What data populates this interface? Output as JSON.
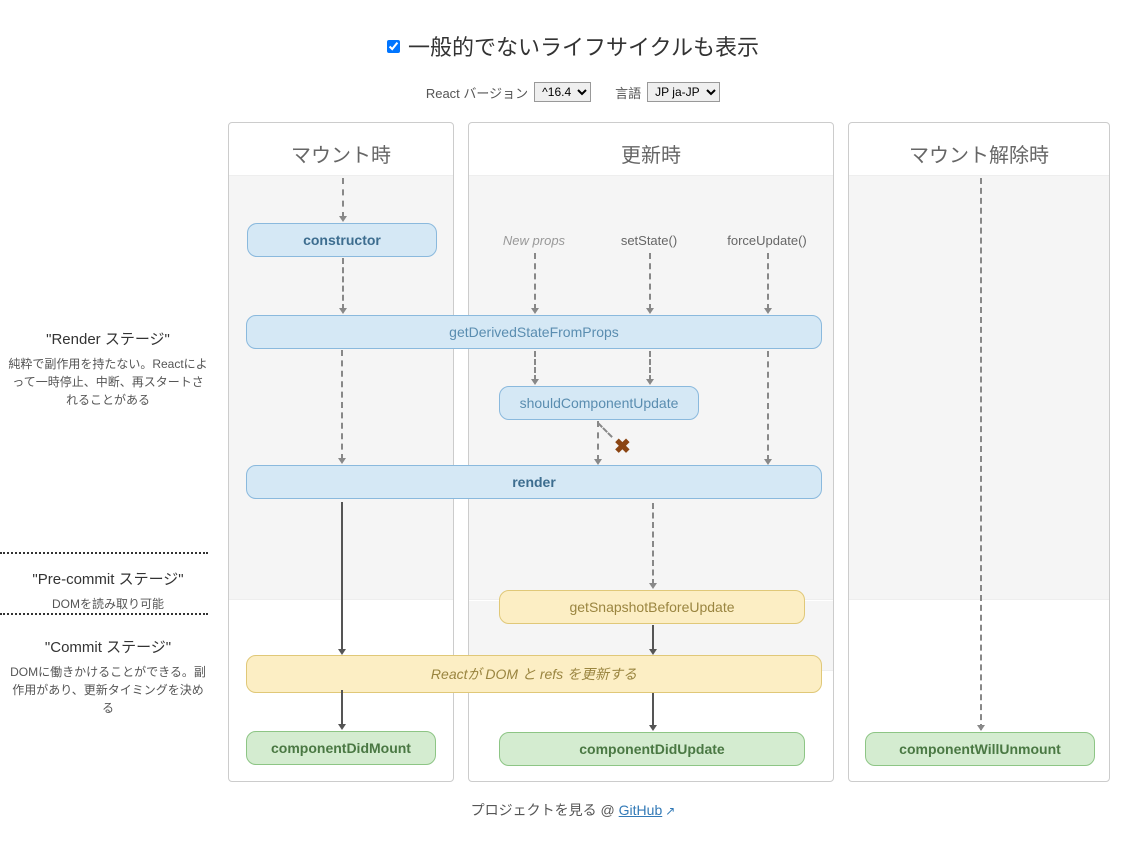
{
  "header": {
    "checkbox_label": "一般的でないライフサイクルも表示"
  },
  "controls": {
    "version_label": "React バージョン",
    "version_value": "^16.4",
    "lang_label": "言語",
    "lang_value": "JP ja-JP"
  },
  "columns": {
    "mounting": "マウント時",
    "updating": "更新時",
    "unmounting": "マウント解除時"
  },
  "stages": {
    "render": {
      "title": "\"Render ステージ\"",
      "desc": "純粋で副作用を持たない。Reactによって一時停止、中断、再スタートされることがある"
    },
    "precommit": {
      "title": "\"Pre-commit ステージ\"",
      "desc": "DOMを読み取り可能"
    },
    "commit": {
      "title": "\"Commit ステージ\"",
      "desc": "DOMに働きかけることができる。副作用があり、更新タイミングを決める"
    }
  },
  "triggers": {
    "new_props": "New props",
    "set_state": "setState()",
    "force_update": "forceUpdate()"
  },
  "methods": {
    "constructor": "constructor",
    "gdsfp": "getDerivedStateFromProps",
    "scu": "shouldComponentUpdate",
    "render": "render",
    "gsbu": "getSnapshotBeforeUpdate",
    "react_updates": "Reactが DOM と refs を更新する",
    "cdm": "componentDidMount",
    "cdu": "componentDidUpdate",
    "cwu": "componentWillUnmount"
  },
  "footer": {
    "text": "プロジェクトを見る @ ",
    "link": "GitHub"
  }
}
